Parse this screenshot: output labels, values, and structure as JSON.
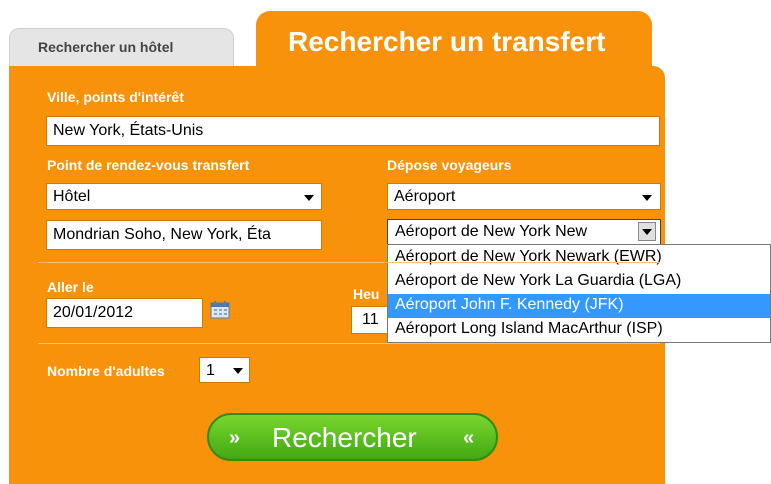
{
  "tabs": {
    "hotel": "Rechercher un hôtel",
    "transfer": "Rechercher un transfert"
  },
  "city": {
    "label": "Ville, points d'intérêt",
    "value": "New York, États-Unis"
  },
  "pickup": {
    "label": "Point de rendez-vous transfert",
    "type": "Hôtel",
    "place": "Mondrian Soho, New York, Éta"
  },
  "dropoff": {
    "label": "Dépose voyageurs",
    "type": "Aéroport",
    "airport": "Aéroport de New York New",
    "options": [
      "Aéroport de New York Newark (EWR)",
      "Aéroport de New York La Guardia (LGA)",
      "Aéroport John F. Kennedy (JFK)",
      "Aéroport Long Island MacArthur (ISP)"
    ],
    "highlighted_index": 2
  },
  "go": {
    "label": "Aller le",
    "date": "20/01/2012"
  },
  "time": {
    "label": "Heu",
    "value": "11"
  },
  "adults": {
    "label": "Nombre d'adultes",
    "value": "1"
  },
  "search_button": {
    "label": "Rechercher",
    "left_chevron": "»",
    "right_chevron": "«"
  },
  "colors": {
    "panel": "#f7920a",
    "highlight": "#3399ff",
    "button": "#42a814"
  }
}
